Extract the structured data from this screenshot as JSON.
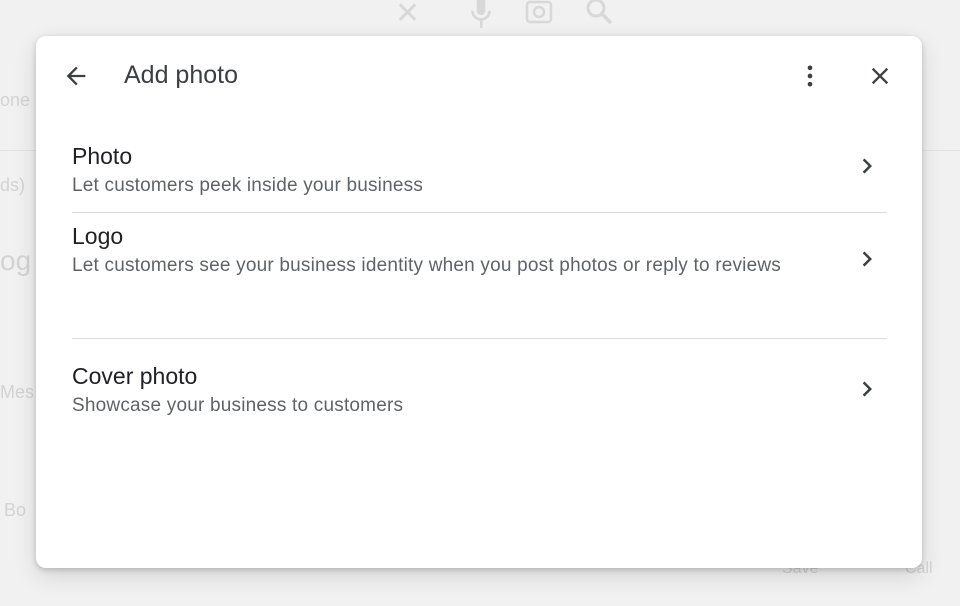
{
  "background": {
    "fragments": [
      "one",
      "ds)",
      "og",
      "Mes",
      "Bo",
      "Save",
      "Call"
    ],
    "icons": [
      "close-icon",
      "microphone-icon",
      "camera-search-icon",
      "search-icon"
    ]
  },
  "dialog": {
    "title": "Add photo",
    "icons": {
      "back": "arrow-back-icon",
      "more": "more-vert-icon",
      "close": "close-icon"
    },
    "items": [
      {
        "title": "Photo",
        "description": "Let customers peek inside your business",
        "icon": "chevron-right-icon"
      },
      {
        "title": "Logo",
        "description": "Let customers see your business identity when you post photos or reply to reviews",
        "icon": "chevron-right-icon"
      },
      {
        "title": "Cover photo",
        "description": "Showcase your business to customers",
        "icon": "chevron-right-icon"
      }
    ]
  },
  "colors": {
    "title": "#3c4043",
    "text_primary": "#202124",
    "text_secondary": "#5f6368",
    "divider": "#dadce0"
  }
}
